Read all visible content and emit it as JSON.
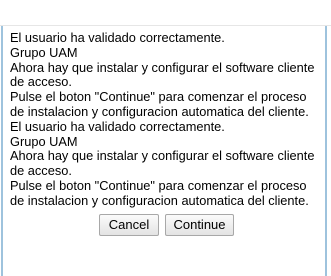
{
  "message": {
    "lines": [
      "El usuario ha validado correctamente.",
      "Grupo UAM",
      "Ahora hay que instalar y configurar el software cliente",
      "de acceso.",
      "Pulse el boton \"Continue\" para comenzar el proceso",
      "de instalacion y configuracion automatica del cliente.",
      "El usuario ha validado correctamente.",
      "Grupo UAM",
      "Ahora hay que instalar y configurar el software cliente",
      "de acceso.",
      "Pulse el boton \"Continue\" para comenzar el proceso",
      "de instalacion y configuracion automatica del cliente."
    ]
  },
  "buttons": {
    "cancel_label": "Cancel",
    "continue_label": "Continue"
  },
  "colors": {
    "frame_border": "#9ec3dd",
    "background": "#ffffff",
    "text": "#000000"
  }
}
